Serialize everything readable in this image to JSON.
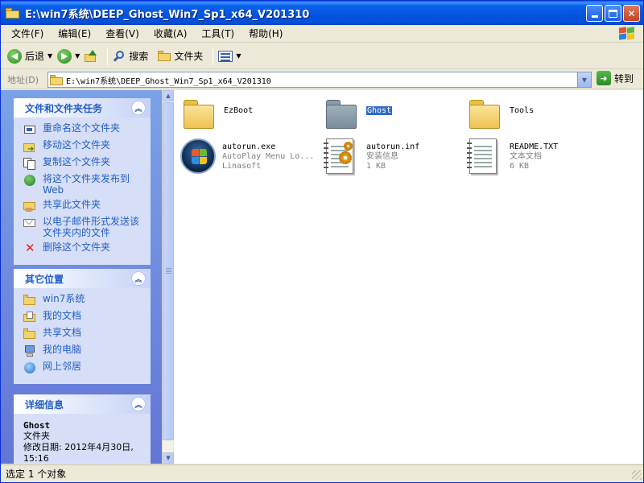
{
  "window": {
    "title": "E:\\win7系统\\DEEP_Ghost_Win7_Sp1_x64_V201310"
  },
  "menu": [
    "文件(F)",
    "编辑(E)",
    "查看(V)",
    "收藏(A)",
    "工具(T)",
    "帮助(H)"
  ],
  "toolbar": {
    "back_label": "后退",
    "search_label": "搜索",
    "folders_label": "文件夹"
  },
  "address": {
    "label": "地址(D)",
    "value": "E:\\win7系统\\DEEP_Ghost_Win7_Sp1_x64_V201310",
    "go_label": "转到"
  },
  "tasks_panel": {
    "title": "文件和文件夹任务",
    "items": [
      {
        "label": "重命名这个文件夹",
        "icon": "rename-icon"
      },
      {
        "label": "移动这个文件夹",
        "icon": "move-icon"
      },
      {
        "label": "复制这个文件夹",
        "icon": "copy-icon"
      },
      {
        "label": "将这个文件夹发布到 Web",
        "icon": "publish-web-icon"
      },
      {
        "label": "共享此文件夹",
        "icon": "share-icon"
      },
      {
        "label": "以电子邮件形式发送该文件夹内的文件",
        "icon": "email-icon"
      },
      {
        "label": "删除这个文件夹",
        "icon": "delete-icon"
      }
    ]
  },
  "places_panel": {
    "title": "其它位置",
    "items": [
      {
        "label": "win7系统",
        "icon": "folder-icon"
      },
      {
        "label": "我的文档",
        "icon": "my-documents-icon"
      },
      {
        "label": "共享文档",
        "icon": "shared-documents-icon"
      },
      {
        "label": "我的电脑",
        "icon": "my-computer-icon"
      },
      {
        "label": "网上邻居",
        "icon": "network-icon"
      }
    ]
  },
  "details_panel": {
    "title": "详细信息",
    "name": "Ghost",
    "type": "文件夹",
    "modified": "修改日期: 2012年4月30日, 15:16"
  },
  "files": [
    {
      "name": "EzBoot",
      "kind": "folder",
      "line2": "",
      "line3": ""
    },
    {
      "name": "Ghost",
      "kind": "folder-selected",
      "line2": "",
      "line3": ""
    },
    {
      "name": "Tools",
      "kind": "folder",
      "line2": "",
      "line3": ""
    },
    {
      "name": "autorun.exe",
      "kind": "exe",
      "line2": "AutoPlay Menu Lo...",
      "line3": "Linasoft"
    },
    {
      "name": "autorun.inf",
      "kind": "inf",
      "line2": "安装信息",
      "line3": "1 KB"
    },
    {
      "name": "README.TXT",
      "kind": "txt",
      "line2": "文本文档",
      "line3": "6 KB"
    }
  ],
  "status": {
    "text": "选定 1 个对象"
  }
}
